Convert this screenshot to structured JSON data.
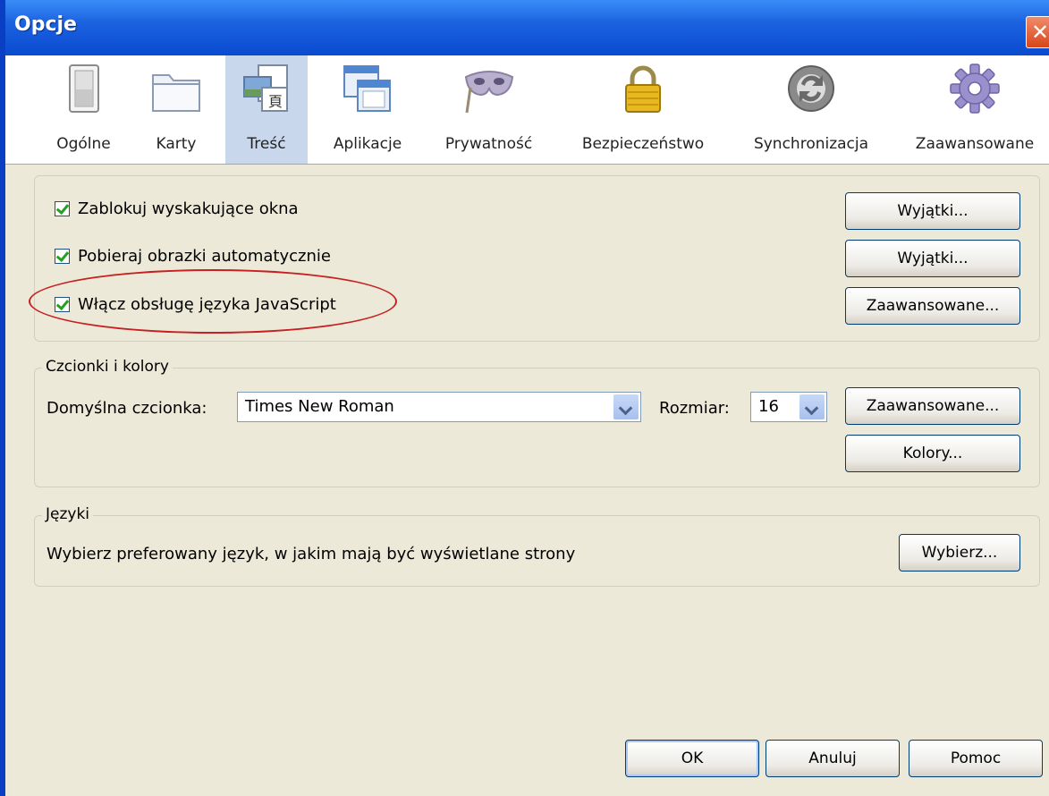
{
  "window": {
    "title": "Opcje"
  },
  "tabs": [
    {
      "label": "Ogólne",
      "icon": "switch-icon"
    },
    {
      "label": "Karty",
      "icon": "folder-tabs-icon"
    },
    {
      "label": "Treść",
      "icon": "content-icon",
      "selected": true
    },
    {
      "label": "Aplikacje",
      "icon": "applications-icon"
    },
    {
      "label": "Prywatność",
      "icon": "mask-icon"
    },
    {
      "label": "Bezpieczeństwo",
      "icon": "padlock-icon"
    },
    {
      "label": "Synchronizacja",
      "icon": "sync-icon"
    },
    {
      "label": "Zaawansowane",
      "icon": "gear-icon"
    }
  ],
  "content": {
    "popups_label": "Zablokuj wyskakujące okna",
    "popups_checked": true,
    "images_label": "Pobieraj obrazki automatycznie",
    "images_checked": true,
    "javascript_label": "Włącz obsługę języka JavaScript",
    "javascript_checked": true,
    "exceptions_btn_1": "Wyjątki...",
    "exceptions_btn_2": "Wyjątki...",
    "advanced_btn": "Zaawansowane..."
  },
  "fonts": {
    "group_title": "Czcionki i kolory",
    "default_font_label": "Domyślna czcionka:",
    "default_font_value": "Times New Roman",
    "size_label": "Rozmiar:",
    "size_value": "16",
    "advanced_btn": "Zaawansowane...",
    "colors_btn": "Kolory..."
  },
  "languages": {
    "group_title": "Języki",
    "description": "Wybierz preferowany język, w jakim mają być wyświetlane strony",
    "choose_btn": "Wybierz..."
  },
  "footer": {
    "ok": "OK",
    "cancel": "Anuluj",
    "help": "Pomoc"
  },
  "colors": {
    "titlebar": "#1c63e0",
    "window_bg": "#ece9d8",
    "highlight_ellipse": "#c62020",
    "selected_tab": "#c8d7ec"
  }
}
